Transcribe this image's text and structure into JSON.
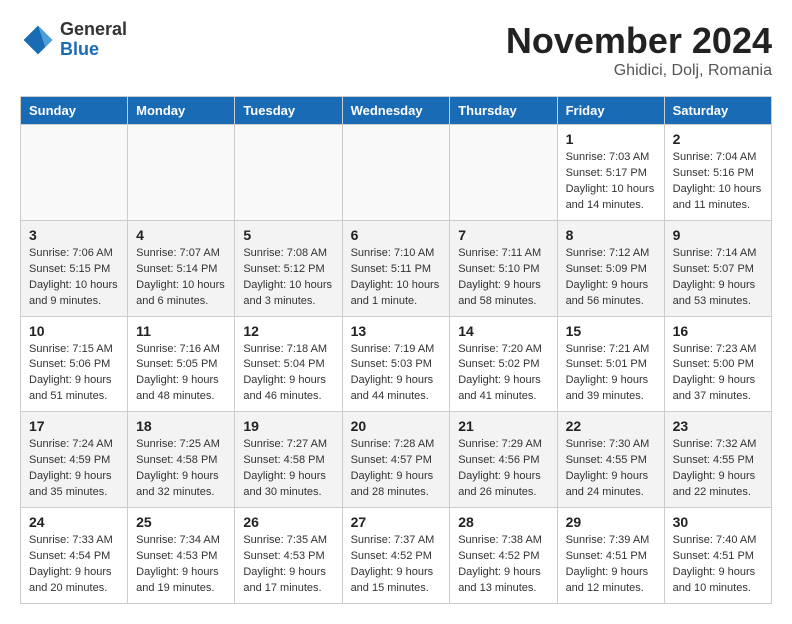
{
  "header": {
    "logo_general": "General",
    "logo_blue": "Blue",
    "month_title": "November 2024",
    "location": "Ghidici, Dolj, Romania"
  },
  "weekdays": [
    "Sunday",
    "Monday",
    "Tuesday",
    "Wednesday",
    "Thursday",
    "Friday",
    "Saturday"
  ],
  "weeks": [
    [
      {
        "day": "",
        "info": ""
      },
      {
        "day": "",
        "info": ""
      },
      {
        "day": "",
        "info": ""
      },
      {
        "day": "",
        "info": ""
      },
      {
        "day": "",
        "info": ""
      },
      {
        "day": "1",
        "info": "Sunrise: 7:03 AM\nSunset: 5:17 PM\nDaylight: 10 hours and 14 minutes."
      },
      {
        "day": "2",
        "info": "Sunrise: 7:04 AM\nSunset: 5:16 PM\nDaylight: 10 hours and 11 minutes."
      }
    ],
    [
      {
        "day": "3",
        "info": "Sunrise: 7:06 AM\nSunset: 5:15 PM\nDaylight: 10 hours and 9 minutes."
      },
      {
        "day": "4",
        "info": "Sunrise: 7:07 AM\nSunset: 5:14 PM\nDaylight: 10 hours and 6 minutes."
      },
      {
        "day": "5",
        "info": "Sunrise: 7:08 AM\nSunset: 5:12 PM\nDaylight: 10 hours and 3 minutes."
      },
      {
        "day": "6",
        "info": "Sunrise: 7:10 AM\nSunset: 5:11 PM\nDaylight: 10 hours and 1 minute."
      },
      {
        "day": "7",
        "info": "Sunrise: 7:11 AM\nSunset: 5:10 PM\nDaylight: 9 hours and 58 minutes."
      },
      {
        "day": "8",
        "info": "Sunrise: 7:12 AM\nSunset: 5:09 PM\nDaylight: 9 hours and 56 minutes."
      },
      {
        "day": "9",
        "info": "Sunrise: 7:14 AM\nSunset: 5:07 PM\nDaylight: 9 hours and 53 minutes."
      }
    ],
    [
      {
        "day": "10",
        "info": "Sunrise: 7:15 AM\nSunset: 5:06 PM\nDaylight: 9 hours and 51 minutes."
      },
      {
        "day": "11",
        "info": "Sunrise: 7:16 AM\nSunset: 5:05 PM\nDaylight: 9 hours and 48 minutes."
      },
      {
        "day": "12",
        "info": "Sunrise: 7:18 AM\nSunset: 5:04 PM\nDaylight: 9 hours and 46 minutes."
      },
      {
        "day": "13",
        "info": "Sunrise: 7:19 AM\nSunset: 5:03 PM\nDaylight: 9 hours and 44 minutes."
      },
      {
        "day": "14",
        "info": "Sunrise: 7:20 AM\nSunset: 5:02 PM\nDaylight: 9 hours and 41 minutes."
      },
      {
        "day": "15",
        "info": "Sunrise: 7:21 AM\nSunset: 5:01 PM\nDaylight: 9 hours and 39 minutes."
      },
      {
        "day": "16",
        "info": "Sunrise: 7:23 AM\nSunset: 5:00 PM\nDaylight: 9 hours and 37 minutes."
      }
    ],
    [
      {
        "day": "17",
        "info": "Sunrise: 7:24 AM\nSunset: 4:59 PM\nDaylight: 9 hours and 35 minutes."
      },
      {
        "day": "18",
        "info": "Sunrise: 7:25 AM\nSunset: 4:58 PM\nDaylight: 9 hours and 32 minutes."
      },
      {
        "day": "19",
        "info": "Sunrise: 7:27 AM\nSunset: 4:58 PM\nDaylight: 9 hours and 30 minutes."
      },
      {
        "day": "20",
        "info": "Sunrise: 7:28 AM\nSunset: 4:57 PM\nDaylight: 9 hours and 28 minutes."
      },
      {
        "day": "21",
        "info": "Sunrise: 7:29 AM\nSunset: 4:56 PM\nDaylight: 9 hours and 26 minutes."
      },
      {
        "day": "22",
        "info": "Sunrise: 7:30 AM\nSunset: 4:55 PM\nDaylight: 9 hours and 24 minutes."
      },
      {
        "day": "23",
        "info": "Sunrise: 7:32 AM\nSunset: 4:55 PM\nDaylight: 9 hours and 22 minutes."
      }
    ],
    [
      {
        "day": "24",
        "info": "Sunrise: 7:33 AM\nSunset: 4:54 PM\nDaylight: 9 hours and 20 minutes."
      },
      {
        "day": "25",
        "info": "Sunrise: 7:34 AM\nSunset: 4:53 PM\nDaylight: 9 hours and 19 minutes."
      },
      {
        "day": "26",
        "info": "Sunrise: 7:35 AM\nSunset: 4:53 PM\nDaylight: 9 hours and 17 minutes."
      },
      {
        "day": "27",
        "info": "Sunrise: 7:37 AM\nSunset: 4:52 PM\nDaylight: 9 hours and 15 minutes."
      },
      {
        "day": "28",
        "info": "Sunrise: 7:38 AM\nSunset: 4:52 PM\nDaylight: 9 hours and 13 minutes."
      },
      {
        "day": "29",
        "info": "Sunrise: 7:39 AM\nSunset: 4:51 PM\nDaylight: 9 hours and 12 minutes."
      },
      {
        "day": "30",
        "info": "Sunrise: 7:40 AM\nSunset: 4:51 PM\nDaylight: 9 hours and 10 minutes."
      }
    ]
  ]
}
